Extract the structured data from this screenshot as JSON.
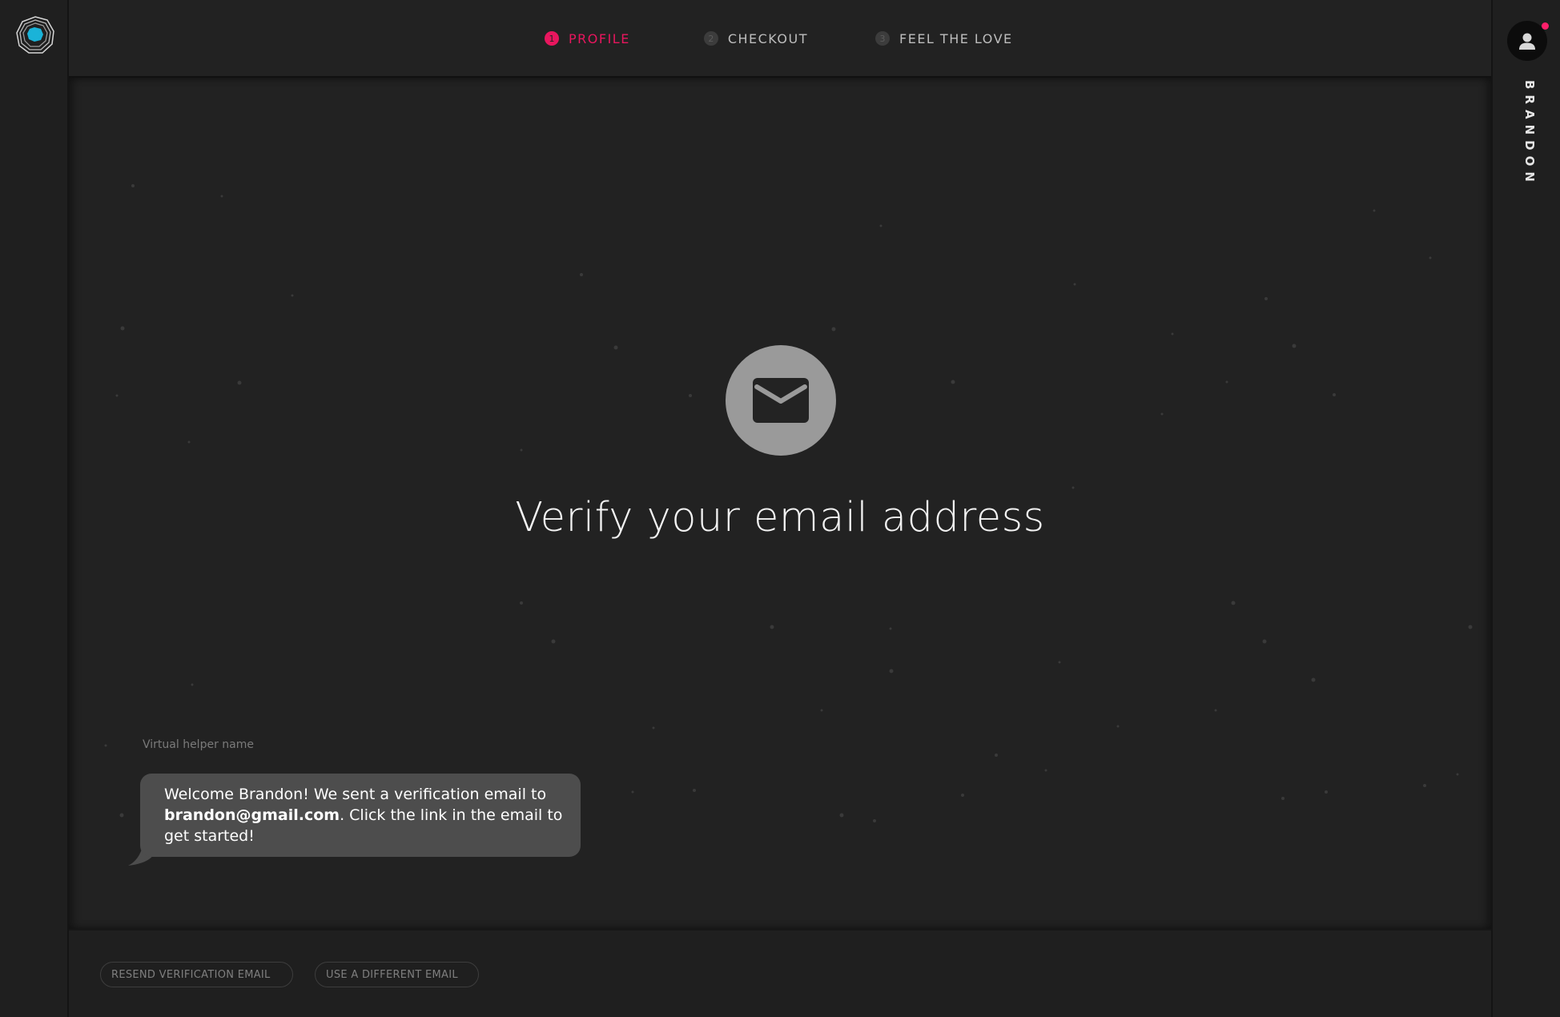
{
  "header": {
    "steps": [
      {
        "number": "1",
        "label": "PROFILE",
        "active": true
      },
      {
        "number": "2",
        "label": "CHECKOUT",
        "active": false
      },
      {
        "number": "3",
        "label": "FEEL THE LOVE",
        "active": false
      }
    ]
  },
  "user": {
    "name": "BRANDON"
  },
  "main": {
    "icon": "envelope-icon",
    "title": "Verify your email address",
    "helper_name": "Virtual helper name",
    "message": {
      "before": "Welcome Brandon! We sent a verification email to ",
      "email": "brandon@gmail.com",
      "after": ". Click the link in the email to get started!"
    }
  },
  "footer": {
    "resend_label": "RESEND VERIFICATION EMAIL",
    "different_label": "USE A DIFFERENT EMAIL"
  },
  "colors": {
    "accent": "#e8165e",
    "logo_center": "#1ab3d8",
    "background": "#232323"
  }
}
